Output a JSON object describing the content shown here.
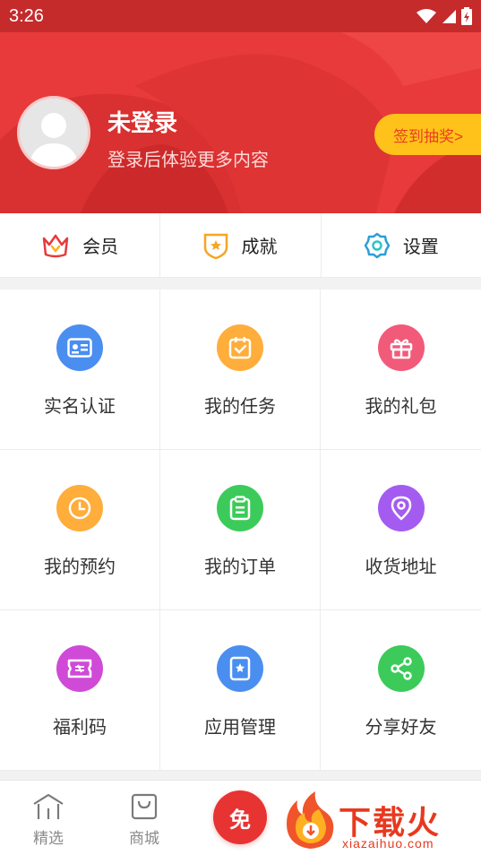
{
  "status_bar": {
    "time": "3:26"
  },
  "profile": {
    "name": "未登录",
    "subtitle": "登录后体验更多内容",
    "checkin_label": "签到抽奖>"
  },
  "quick_links": [
    {
      "label": "会员",
      "icon": "crown-icon"
    },
    {
      "label": "成就",
      "icon": "badge-icon"
    },
    {
      "label": "设置",
      "icon": "gear-icon"
    }
  ],
  "grid_items": [
    {
      "label": "实名认证",
      "icon": "id-card-icon",
      "color": "#4a8ef0"
    },
    {
      "label": "我的任务",
      "icon": "task-icon",
      "color": "#ffad3b"
    },
    {
      "label": "我的礼包",
      "icon": "gift-icon",
      "color": "#f25a7a"
    },
    {
      "label": "我的预约",
      "icon": "clock-icon",
      "color": "#ffad3b"
    },
    {
      "label": "我的订单",
      "icon": "order-icon",
      "color": "#3ccb5a"
    },
    {
      "label": "收货地址",
      "icon": "location-icon",
      "color": "#a45cf0"
    },
    {
      "label": "福利码",
      "icon": "ticket-icon",
      "color": "#d04ad8"
    },
    {
      "label": "应用管理",
      "icon": "app-manage-icon",
      "color": "#4a8ef0"
    },
    {
      "label": "分享好友",
      "icon": "share-icon",
      "color": "#3ccb5a"
    }
  ],
  "bottom_nav": {
    "featured_label": "精选",
    "mall_label": "商城",
    "free_label": "免"
  },
  "watermark": {
    "text": "下载火",
    "url": "xiazaihuo.com"
  },
  "colors": {
    "header_red": "#e83a3a",
    "status_red": "#c52b2b",
    "checkin_yellow": "#ffc21a"
  }
}
